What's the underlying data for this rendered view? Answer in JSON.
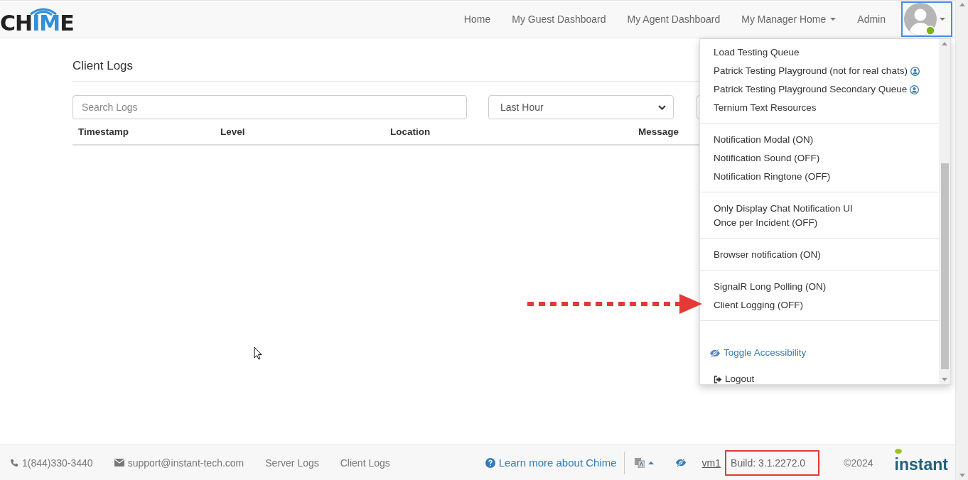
{
  "logo": {
    "parts": [
      {
        "text": "CH",
        "accent": false
      },
      {
        "text": "IM",
        "accent": true
      },
      {
        "text": "E",
        "accent": false
      }
    ]
  },
  "nav": [
    {
      "label": "Home",
      "dropdown": false
    },
    {
      "label": "My Guest Dashboard",
      "dropdown": false
    },
    {
      "label": "My Agent Dashboard",
      "dropdown": false
    },
    {
      "label": "My Manager Home",
      "dropdown": true
    },
    {
      "label": "Admin",
      "dropdown": false
    }
  ],
  "user_menu": {
    "open": true,
    "groups": [
      [
        {
          "text": "Load Testing Queue",
          "kind": "plain"
        },
        {
          "text": "Patrick Testing Playground (not for real chats)",
          "kind": "queue"
        },
        {
          "text": "Patrick Testing Playground Secondary Queue",
          "kind": "queue"
        },
        {
          "text": "Ternium Text Resources",
          "kind": "plain"
        }
      ],
      [
        {
          "text": "Notification Modal (ON)",
          "kind": "plain"
        },
        {
          "text": "Notification Sound (OFF)",
          "kind": "plain"
        },
        {
          "text": "Notification Ringtone (OFF)",
          "kind": "plain"
        }
      ],
      [
        {
          "text": "Only Display Chat Notification UI\nOnce per Incident (OFF)",
          "kind": "plain"
        }
      ],
      [
        {
          "text": "Browser notification (ON)",
          "kind": "plain"
        }
      ],
      [
        {
          "text": "SignalR Long Polling (ON)",
          "kind": "plain"
        },
        {
          "text": "Client Logging (OFF)",
          "kind": "plain"
        }
      ],
      [
        {
          "text": "Toggle Accessibility",
          "kind": "accessibility"
        },
        {
          "text": "Logout",
          "kind": "logout"
        }
      ]
    ]
  },
  "page": {
    "title": "Client Logs",
    "search": {
      "placeholder": "Search Logs"
    },
    "range": {
      "value": "Last Hour"
    },
    "table": {
      "columns": [
        "Timestamp",
        "Level",
        "Location",
        "Message"
      ]
    }
  },
  "footer": {
    "phone": "1(844)330-3440",
    "email": "support@instant-tech.com",
    "links": [
      "Server Logs",
      "Client Logs"
    ],
    "learn_more": "Learn more about Chime",
    "vm": "vm1",
    "build": "Build: 3.1.2272.0",
    "copyright": "©2024",
    "brand": "instant"
  }
}
